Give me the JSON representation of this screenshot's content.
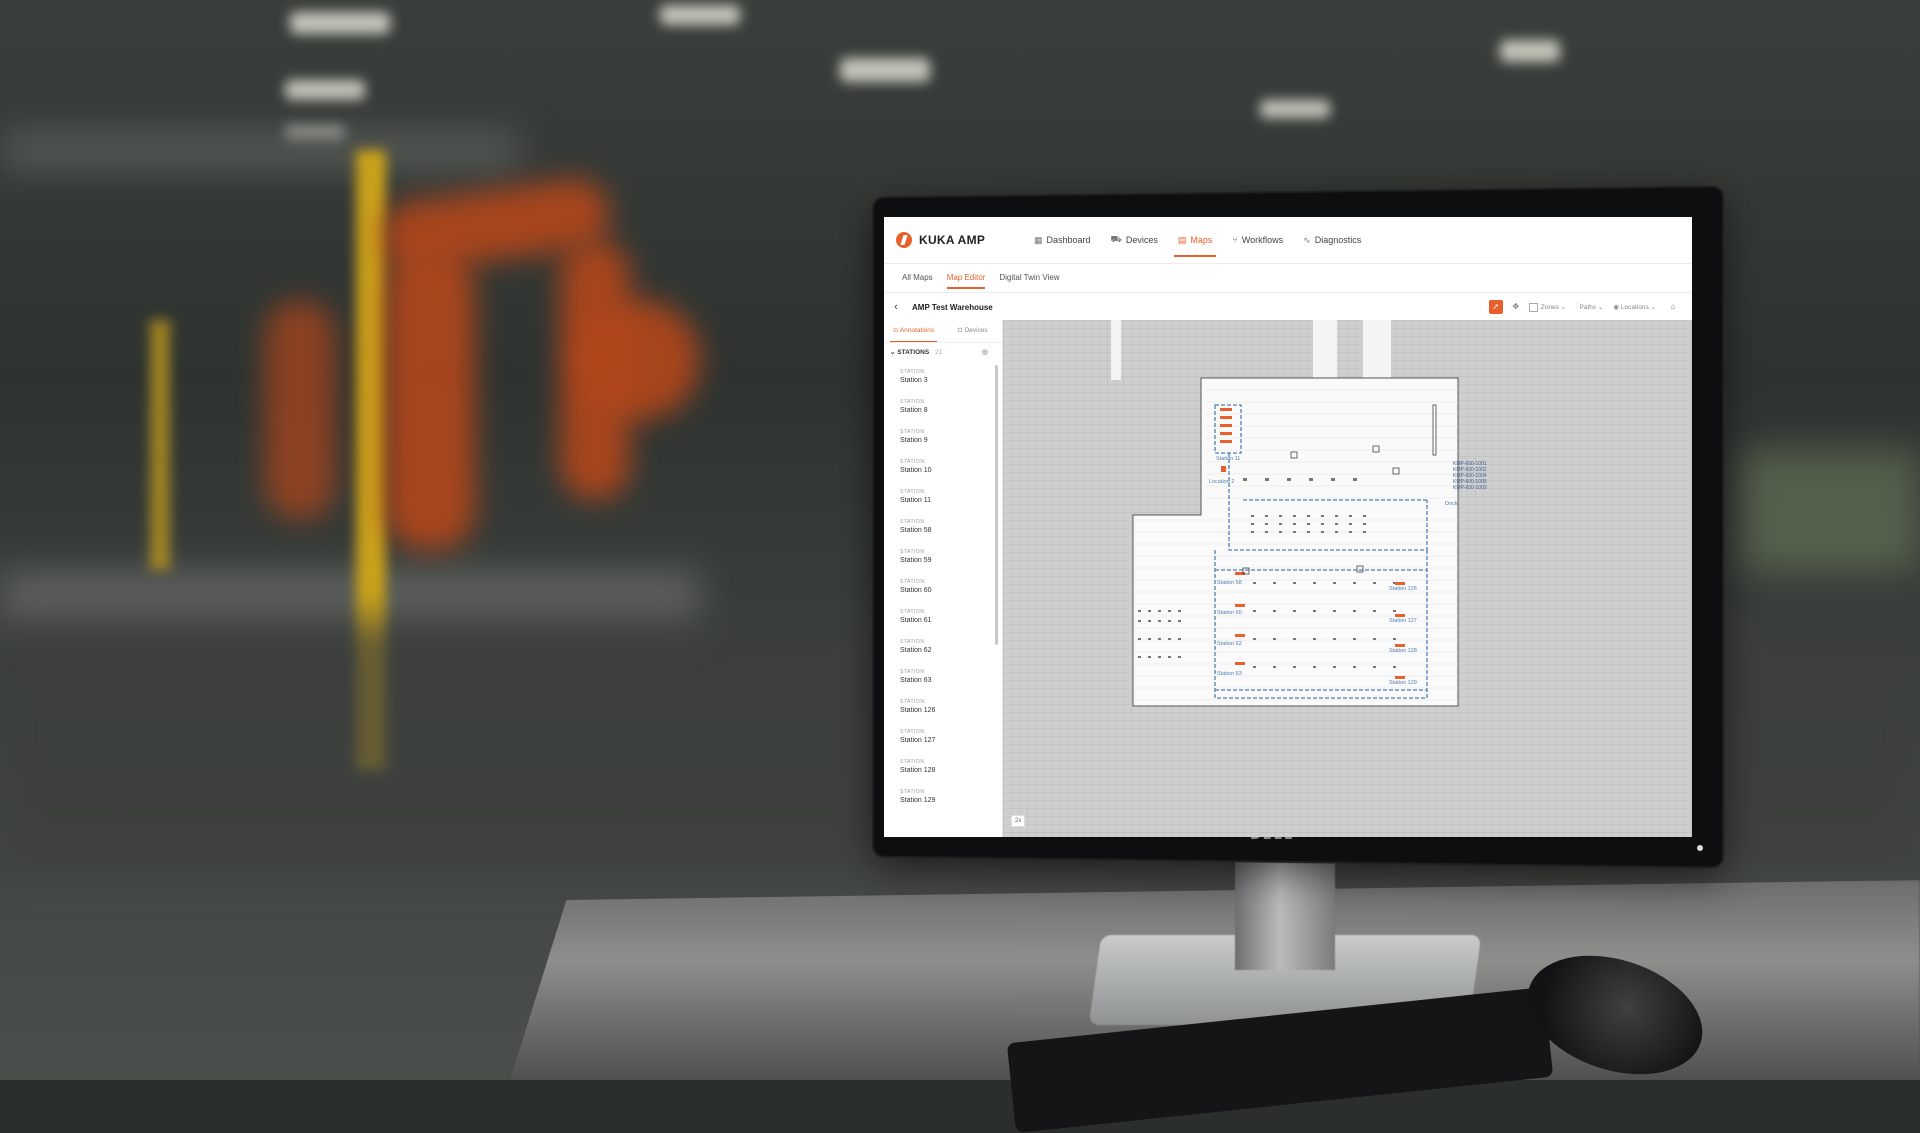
{
  "app": {
    "brand": "KUKA AMP",
    "monitor_brand": "DELL"
  },
  "nav": {
    "items": [
      {
        "label": "Dashboard",
        "icon": "dashboard-icon",
        "active": false
      },
      {
        "label": "Devices",
        "icon": "devices-icon",
        "active": false
      },
      {
        "label": "Maps",
        "icon": "map-icon",
        "active": true
      },
      {
        "label": "Workflows",
        "icon": "workflow-icon",
        "active": false
      },
      {
        "label": "Diagnostics",
        "icon": "diagnostics-icon",
        "active": false
      }
    ]
  },
  "subtabs": [
    {
      "label": "All Maps",
      "active": false
    },
    {
      "label": "Map Editor",
      "active": true
    },
    {
      "label": "Digital Twin View",
      "active": false
    }
  ],
  "toolbar": {
    "map_name": "AMP Test Warehouse",
    "filters": [
      "Zones",
      "Paths",
      "Locations"
    ]
  },
  "sidebar": {
    "tabs": [
      {
        "label": "Annotations",
        "active": true
      },
      {
        "label": "Devices",
        "active": false
      }
    ],
    "section": {
      "title": "STATIONS",
      "count": "21"
    },
    "item_kind": "STATION",
    "stations": [
      "Station 3",
      "Station 8",
      "Station 9",
      "Station 10",
      "Station 11",
      "Station 58",
      "Station 59",
      "Station 60",
      "Station 61",
      "Station 62",
      "Station 63",
      "Station 126",
      "Station 127",
      "Station 128",
      "Station 129"
    ]
  },
  "map": {
    "zoom": "2x",
    "labels": {
      "station_11": "Station 11",
      "location_2": "Location 2",
      "dock": "Dock",
      "station_58": "Station 58",
      "station_60": "Station 60",
      "station_62": "Station 62",
      "station_63": "Station 63",
      "station_126": "Station 126",
      "station_127": "Station 127",
      "station_128": "Station 128",
      "station_129": "Station 129"
    },
    "devices": [
      "KMP-600-1001",
      "KMP-600-1002",
      "KMP-600-1004",
      "KMP-600-1005",
      "KMP-600-1003"
    ],
    "colors": {
      "accent": "#e8602c",
      "path": "#4f7fb8"
    }
  }
}
